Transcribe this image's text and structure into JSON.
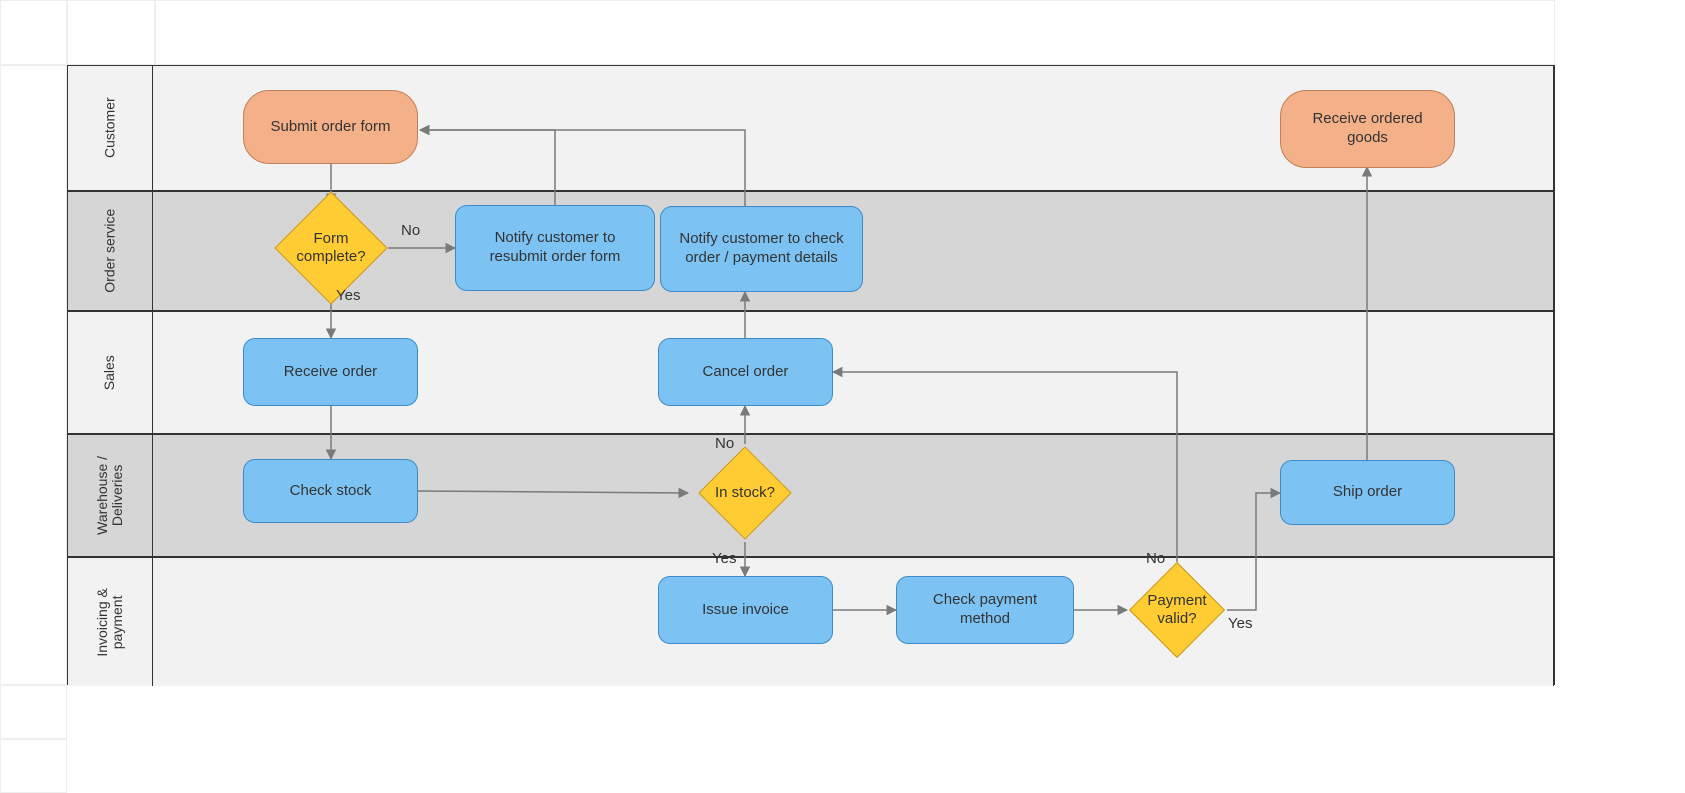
{
  "lanes": {
    "customer": "Customer",
    "order_service": "Order service",
    "sales": "Sales",
    "warehouse": "Warehouse /\nDeliveries",
    "invoicing": "Invoicing &\npayment"
  },
  "nodes": {
    "submit_order": "Submit order form",
    "receive_goods": "Receive ordered goods",
    "form_complete": "Form complete?",
    "notify_resubmit": "Notify customer to resubmit order form",
    "notify_check": "Notify customer to check order / payment details",
    "receive_order": "Receive order",
    "cancel_order": "Cancel order",
    "check_stock": "Check stock",
    "in_stock": "In stock?",
    "ship_order": "Ship order",
    "issue_invoice": "Issue invoice",
    "check_payment": "Check payment method",
    "payment_valid": "Payment valid?"
  },
  "edge_labels": {
    "form_no": "No",
    "form_yes": "Yes",
    "stock_no": "No",
    "stock_yes": "Yes",
    "pay_no": "No",
    "pay_yes": "Yes"
  },
  "colors": {
    "terminator_fill": "#f4b189",
    "terminator_stroke": "#c28058",
    "process_fill": "#7cc3f4",
    "process_stroke": "#3b8cc6",
    "decision_fill": "#ffcc33",
    "decision_stroke": "#c89a20",
    "lane_light": "#f2f2f2",
    "lane_dark": "#d6d6d6",
    "edge": "#7a7a7a"
  }
}
